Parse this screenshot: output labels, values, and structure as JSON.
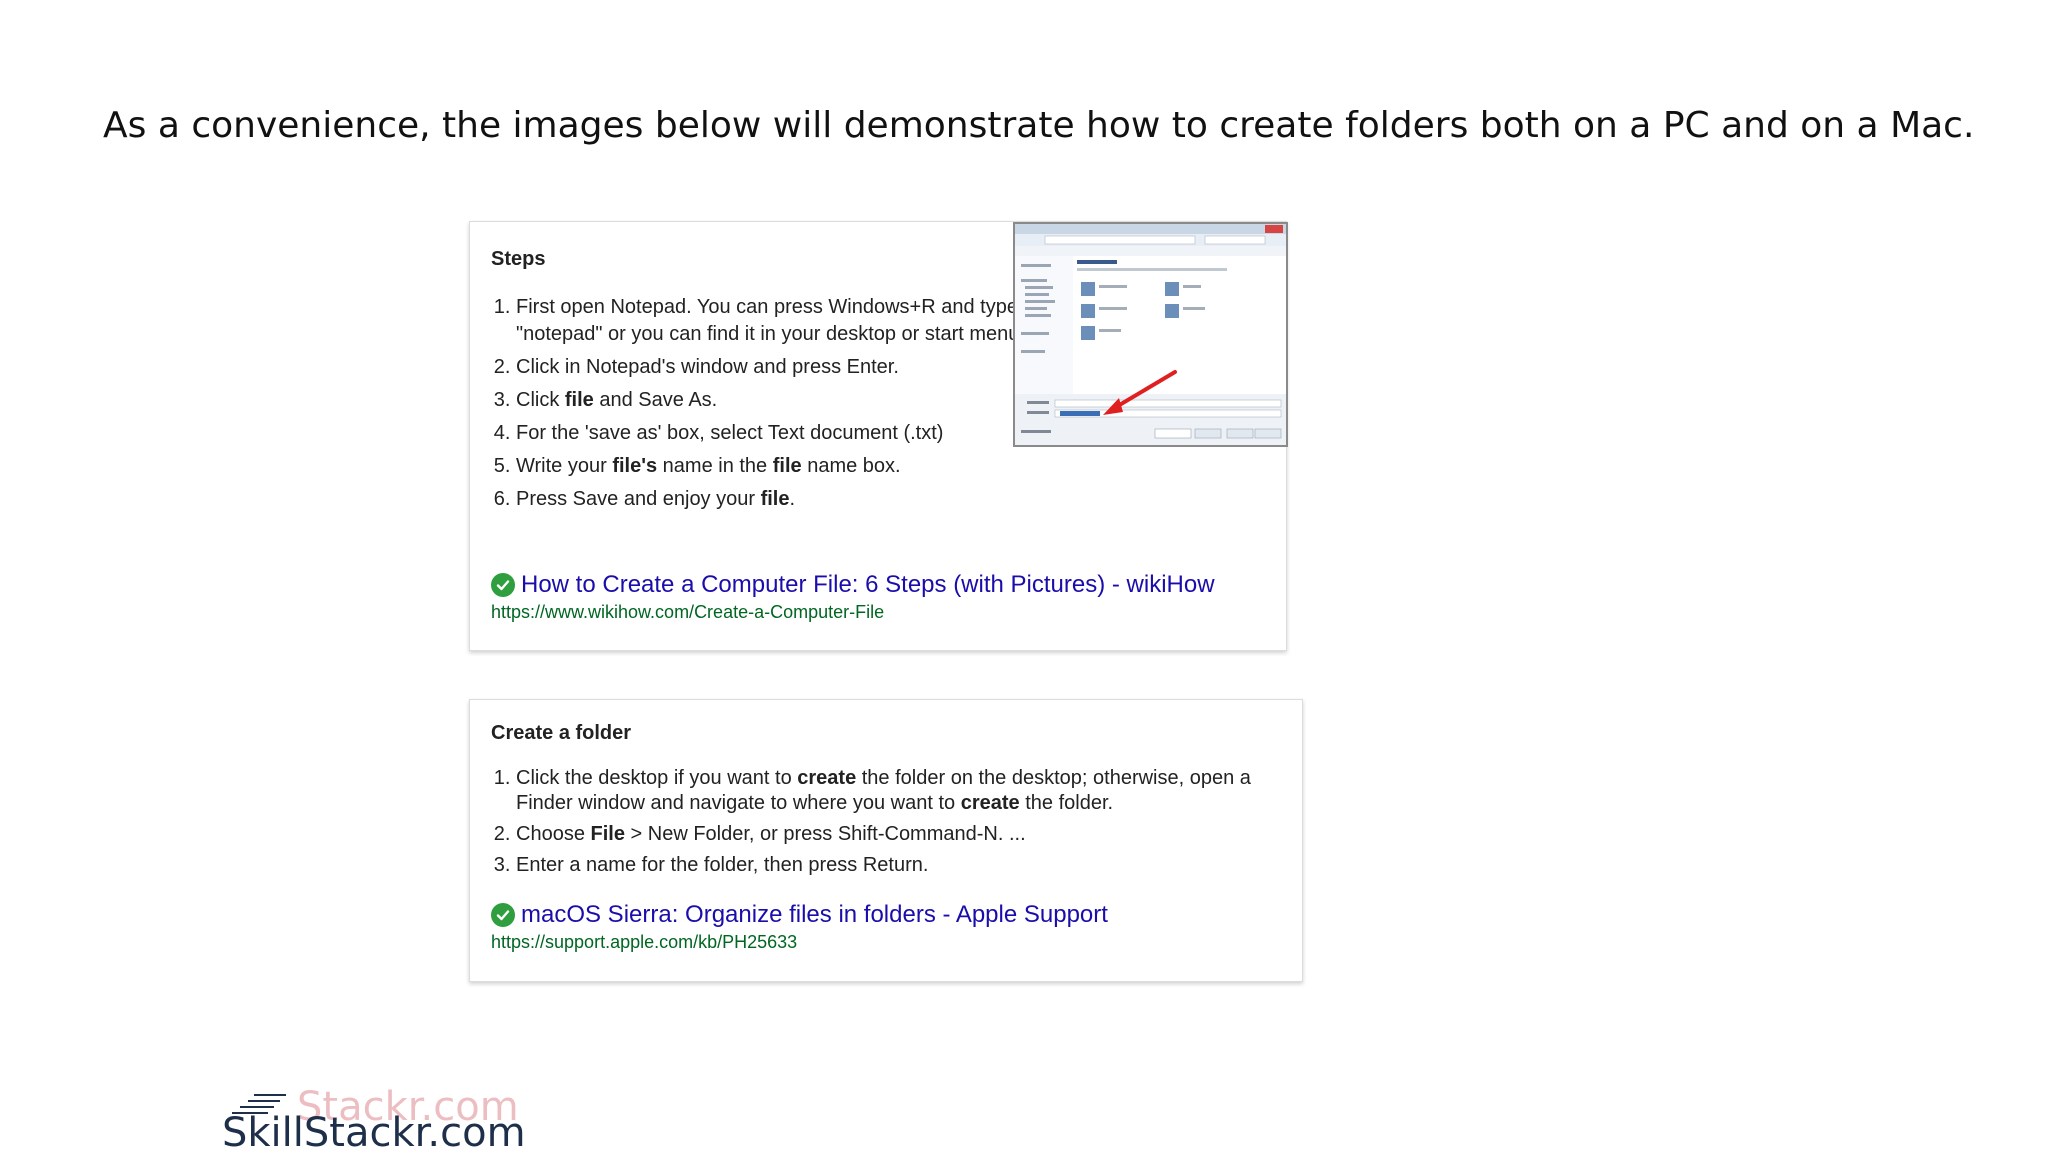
{
  "headline": "As a convenience, the images below will demonstrate how to create folders both on a PC and on a Mac.",
  "card_pc": {
    "heading": "Steps",
    "steps": [
      {
        "parts": [
          "First open Notepad. You can press Windows+R and type in \"notepad\" or you can find it in your desktop or start menu."
        ]
      },
      {
        "parts": [
          "Click in Notepad's window and press Enter."
        ]
      },
      {
        "parts": [
          "Click ",
          "file",
          " and Save As."
        ]
      },
      {
        "parts": [
          "For the 'save as' box, select Text document (.txt)"
        ]
      },
      {
        "parts": [
          "Write your ",
          "file's",
          " name in the ",
          "file",
          " name box."
        ]
      },
      {
        "parts": [
          "Press Save and enjoy your ",
          "file",
          "."
        ]
      }
    ],
    "result_title": "How to Create a Computer File: 6 Steps (with Pictures) - wikiHow",
    "result_url": "https://www.wikihow.com/Create-a-Computer-File"
  },
  "card_mac": {
    "heading": "Create a folder",
    "steps": [
      {
        "parts": [
          "Click the desktop if you want to ",
          "create",
          " the folder on the desktop; otherwise, open a Finder window and navigate to where you want to ",
          "create",
          " the folder."
        ]
      },
      {
        "parts": [
          "Choose ",
          "File",
          " > New Folder, or press Shift-Command-N. ..."
        ]
      },
      {
        "parts": [
          "Enter a name for the folder, then press Return."
        ]
      }
    ],
    "result_title": "macOS Sierra: Organize files in folders - Apple Support",
    "result_url": "https://support.apple.com/kb/PH25633"
  },
  "logo": {
    "text": "SkillStackr.com",
    "ghost_text": "Stackr.com"
  },
  "icons": {
    "check": "check-circle-icon",
    "thumbnail": "save-dialog-screenshot",
    "arrow": "red-arrow-icon"
  },
  "colors": {
    "link": "#1a0dab",
    "url": "#006621",
    "check": "#2e9e3e",
    "arrow": "#e02020"
  }
}
